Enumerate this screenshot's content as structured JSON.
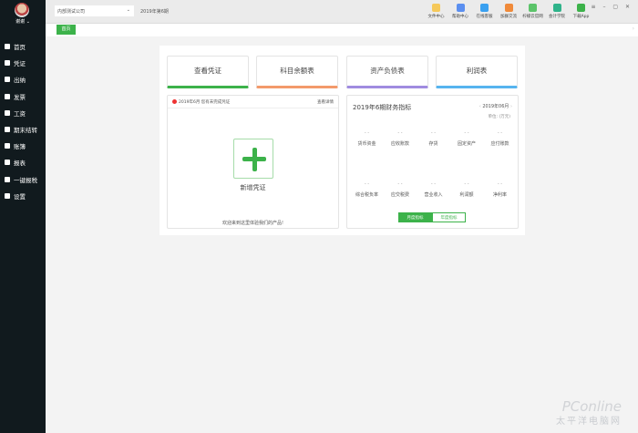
{
  "user": {
    "name": "谢谢"
  },
  "sidebar": {
    "items": [
      {
        "label": "首页"
      },
      {
        "label": "凭证"
      },
      {
        "label": "出纳"
      },
      {
        "label": "发票"
      },
      {
        "label": "工资"
      },
      {
        "label": "期末结转"
      },
      {
        "label": "账簿"
      },
      {
        "label": "报表"
      },
      {
        "label": "一键报税"
      },
      {
        "label": "设置"
      }
    ]
  },
  "topbar": {
    "company": "内部测试公司",
    "period": "2019年第6期",
    "tools": [
      {
        "label": "文件中心",
        "color": "#f5c85a"
      },
      {
        "label": "帮助中心",
        "color": "#5b8ff0"
      },
      {
        "label": "在线客服",
        "color": "#3aa0f0"
      },
      {
        "label": "加群交流",
        "color": "#f08a3a"
      },
      {
        "label": "柠檬云官网",
        "color": "#5cc46a"
      },
      {
        "label": "会计学院",
        "color": "#2fb38a"
      },
      {
        "label": "下载App",
        "color": "#3cb24a"
      }
    ]
  },
  "tabs": {
    "active": "首页"
  },
  "cards": [
    {
      "label": "查看凭证",
      "color": "#3cb24a"
    },
    {
      "label": "科目余额表",
      "color": "#f39a6b"
    },
    {
      "label": "资产负债表",
      "color": "#a08ce0"
    },
    {
      "label": "利润表",
      "color": "#56b4ef"
    }
  ],
  "voucher": {
    "notice": "2019年6月 您有未完成凭证",
    "detail_link": "查看详情",
    "add_label": "新增凭证",
    "welcome": "欢迎来到这里体验我们的产品!"
  },
  "indicators": {
    "title": "2019年6期财务指标",
    "month": "2019年06月",
    "unit": "单位: (万元)",
    "items": [
      {
        "label": "货币资金",
        "value": "- -"
      },
      {
        "label": "应收账款",
        "value": "- -"
      },
      {
        "label": "存货",
        "value": "- -"
      },
      {
        "label": "固定资产",
        "value": "- -"
      },
      {
        "label": "应付账款",
        "value": "- -"
      },
      {
        "label": "综合税负率",
        "value": "- -"
      },
      {
        "label": "应交税费",
        "value": "- -"
      },
      {
        "label": "营业收入",
        "value": "- -"
      },
      {
        "label": "利润额",
        "value": "- -"
      },
      {
        "label": "净利率",
        "value": "- -"
      }
    ],
    "btn_month": "月度指标",
    "btn_year": "年度指标"
  },
  "watermark": {
    "text": "PConline",
    "sub": "太平洋电脑网"
  }
}
